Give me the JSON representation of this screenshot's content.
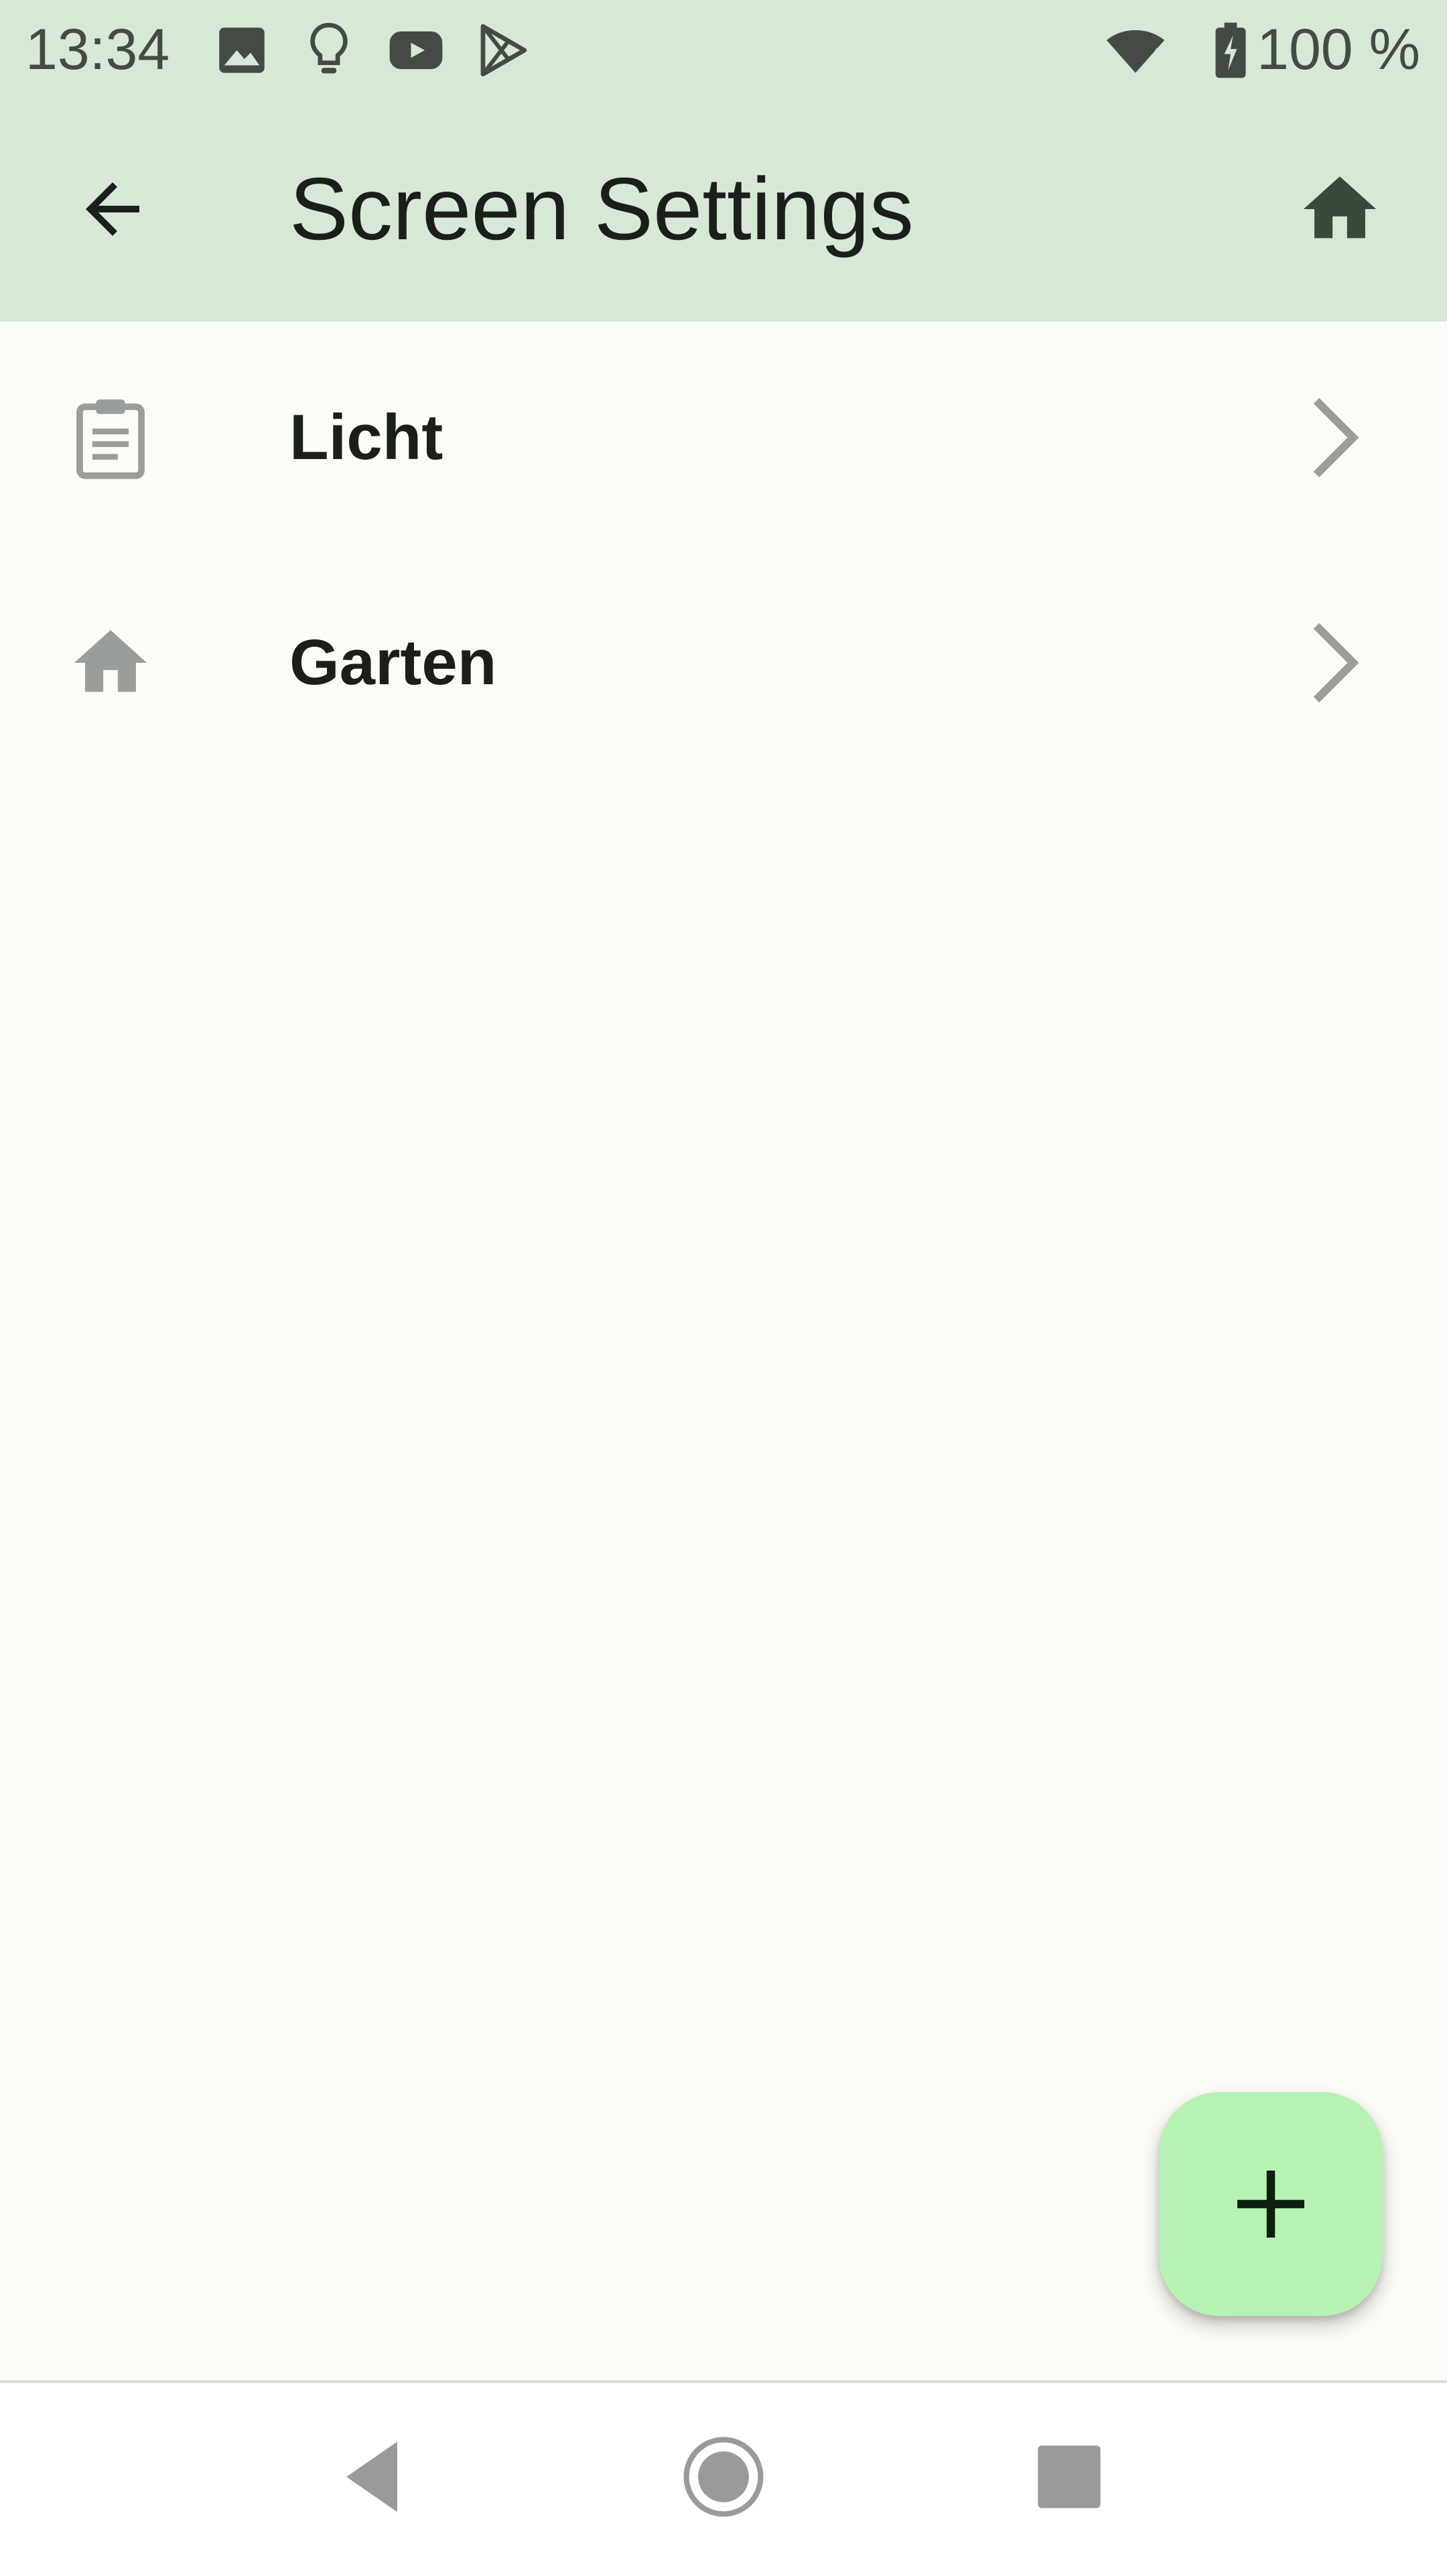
{
  "status_bar": {
    "time": "13:34",
    "battery_text": "100 %",
    "icons": [
      "image-icon",
      "lightbulb-icon",
      "youtube-icon",
      "play-store-icon",
      "wifi-icon",
      "battery-charging-icon"
    ]
  },
  "app_bar": {
    "title": "Screen Settings",
    "back_icon": "arrow-back-icon",
    "home_icon": "home-icon"
  },
  "list": {
    "items": [
      {
        "label": "Licht",
        "icon": "clipboard-icon"
      },
      {
        "label": "Garten",
        "icon": "home-icon"
      }
    ]
  },
  "fab": {
    "icon": "plus-icon"
  },
  "nav_bar": {
    "icons": [
      "nav-back-icon",
      "nav-home-icon",
      "nav-recents-icon"
    ]
  },
  "colors": {
    "app_bar_bg": "#d8e8d6",
    "background": "#fbfcf7",
    "fab_bg": "#b7f2b3",
    "icon_grey": "#9a9e9a",
    "text_dark": "#1b1f1b"
  }
}
